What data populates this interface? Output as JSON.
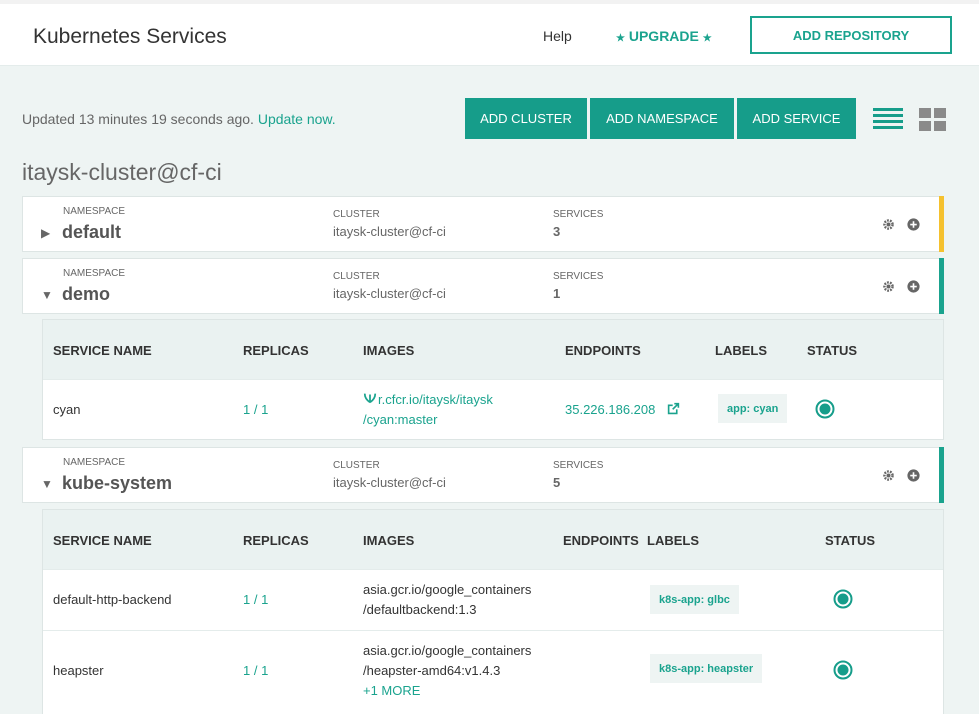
{
  "header": {
    "title": "Kubernetes Services",
    "help": "Help",
    "upgrade": "UPGRADE",
    "upgrade_star": "★",
    "add_repository": "ADD REPOSITORY"
  },
  "toolbar": {
    "updated_text": "Updated 13 minutes 19 seconds ago.",
    "update_now": "Update now.",
    "add_cluster": "ADD CLUSTER",
    "add_namespace": "ADD NAMESPACE",
    "add_service": "ADD SERVICE"
  },
  "cluster": {
    "title": "itaysk-cluster@cf-ci"
  },
  "labels": {
    "namespace": "NAMESPACE",
    "cluster": "CLUSTER",
    "services": "SERVICES"
  },
  "table_headers": {
    "service_name": "SERVICE NAME",
    "replicas": "REPLICAS",
    "images": "IMAGES",
    "endpoints": "ENDPOINTS",
    "labels": "LABELS",
    "status": "STATUS"
  },
  "namespaces": [
    {
      "name": "default",
      "cluster": "itaysk-cluster@cf-ci",
      "services": "3",
      "accent": "#f5c12e",
      "expanded": false
    },
    {
      "name": "demo",
      "cluster": "itaysk-cluster@cf-ci",
      "services": "1",
      "accent": "#1aa38e",
      "expanded": true,
      "rows": [
        {
          "name": "cyan",
          "replicas": "1 / 1",
          "image_line1": "r.cfcr.io/itaysk/itaysk",
          "image_line2": "/cyan:master",
          "endpoint": "35.226.186.208",
          "label": "app: cyan"
        }
      ]
    },
    {
      "name": "kube-system",
      "cluster": "itaysk-cluster@cf-ci",
      "services": "5",
      "accent": "#1aa38e",
      "expanded": true,
      "rows": [
        {
          "name": "default-http-backend",
          "replicas": "1 / 1",
          "image_line1": "asia.gcr.io/google_containers",
          "image_line2": "/defaultbackend:1.3",
          "label": "k8s-app: glbc"
        },
        {
          "name": "heapster",
          "replicas": "1 / 1",
          "image_line1": "asia.gcr.io/google_containers",
          "image_line2": "/heapster-amd64:v1.4.3",
          "more": "+1 MORE",
          "label": "k8s-app: heapster"
        }
      ]
    }
  ],
  "colors": {
    "accent": "#1aa38e",
    "warning": "#f5c12e"
  },
  "icons": [
    "gear-icon",
    "plus-icon",
    "caret-right-icon",
    "caret-down-icon",
    "external-link-icon",
    "status-icon",
    "list-view-icon",
    "grid-view-icon",
    "registry-icon"
  ]
}
